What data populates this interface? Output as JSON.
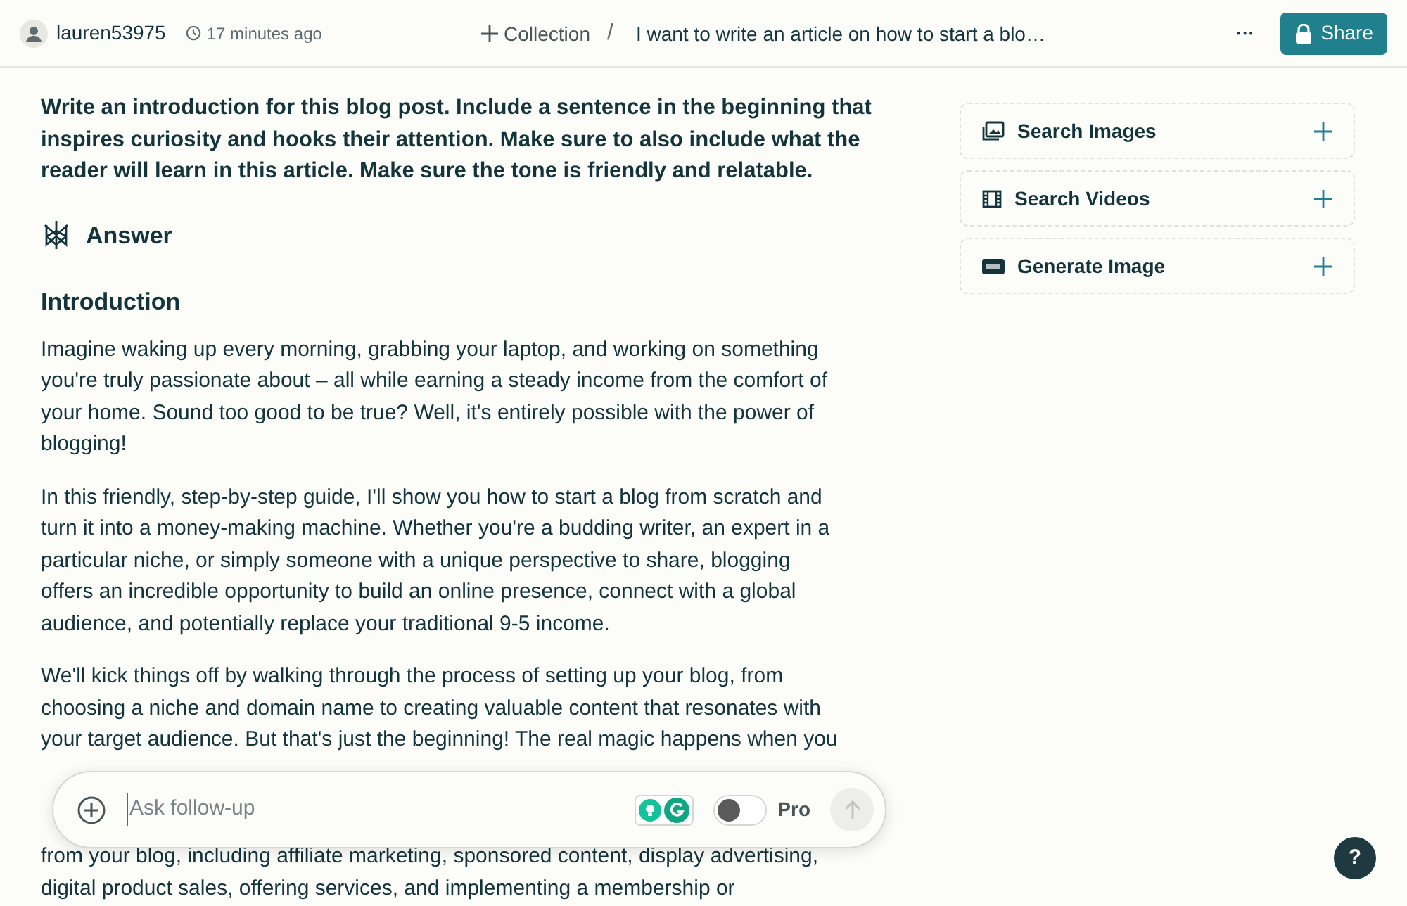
{
  "header": {
    "username": "lauren53975",
    "time": "17 minutes ago",
    "collection": "Collection",
    "separator": "/",
    "thread_title": "I want to write an article on how to start a blo…",
    "more": "···",
    "share": "Share"
  },
  "prompt": "Write an introduction for this blog post. Include a sentence in the beginning that inspires curiosity and hooks their attention. Make sure to also include what the reader will learn in this article. Make sure the tone is friendly and relatable.",
  "answer_label": "Answer",
  "answer": {
    "heading": "Introduction",
    "paragraphs": [
      [
        "Imagine waking up every morning, grabbing your laptop, and working on something",
        "you're truly passionate about – all while earning a steady income from the comfort of",
        "your home. Sound too good to be true? Well, it's entirely possible with the power of",
        "blogging!"
      ],
      [
        "In this friendly, step-by-step guide, I'll show you how to start a blog from scratch and",
        "turn it into a money-making machine. Whether you're a budding writer, an expert in a",
        "particular niche, or simply someone with a unique perspective to share, blogging",
        "offers an incredible opportunity to build an online presence, connect with a global",
        "audience, and potentially replace your traditional 9-5 income."
      ],
      [
        "We'll kick things off by walking through the process of setting up your blog, from",
        "choosing a niche and domain name to creating valuable content that resonates with",
        "your target audience. But that's just the beginning! The real magic happens when you"
      ]
    ],
    "continued_lines": [
      "from your blog, including affiliate marketing, sponsored content, display advertising,",
      "digital product sales, offering services, and implementing a membership or"
    ]
  },
  "sidebar": [
    {
      "kind": "images",
      "label": "Search Images"
    },
    {
      "kind": "videos",
      "label": "Search Videos"
    },
    {
      "kind": "generate",
      "label": "Generate Image"
    }
  ],
  "follow_up": {
    "placeholder": "Ask follow-up",
    "pro_label": "Pro",
    "pro": {
      "on": false
    }
  },
  "help": "?"
}
